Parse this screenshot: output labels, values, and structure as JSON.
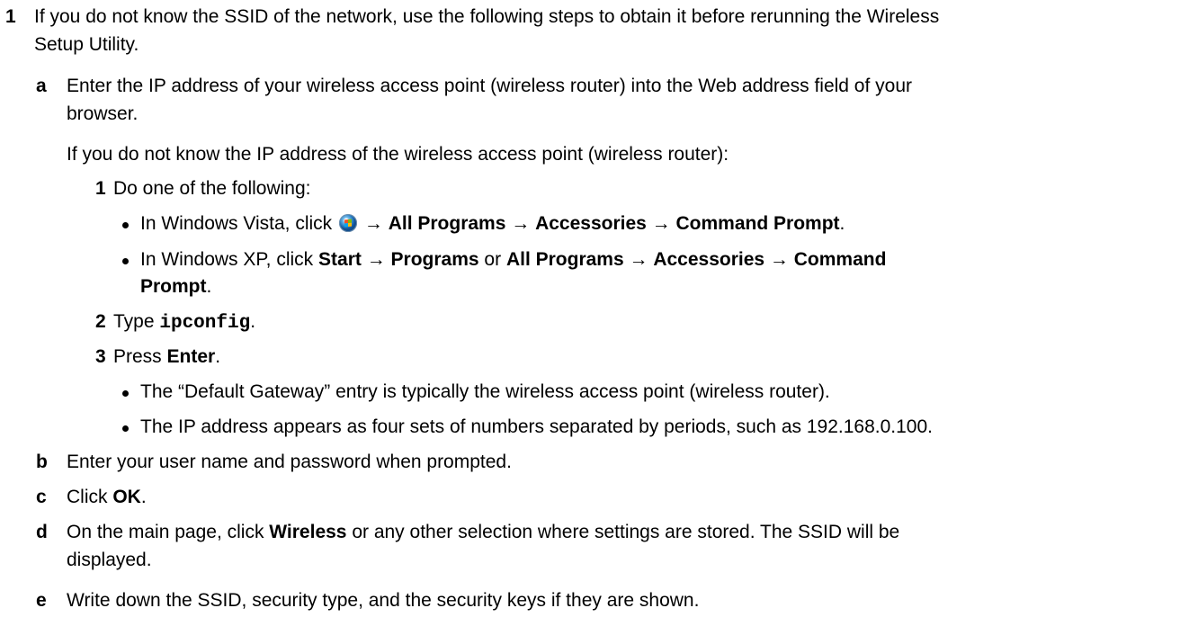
{
  "step1": {
    "num": "1",
    "text_l1": "If you do not know the SSID of the network, use the following steps to obtain it before rerunning the Wireless",
    "text_l2": "Setup Utility."
  },
  "a": {
    "letter": "a",
    "text_l1": "Enter the IP address of your wireless access point (wireless router) into the Web address field of your",
    "text_l2": "browser.",
    "intro": "If you do not know the IP address of the wireless access point (wireless router):",
    "sub1": {
      "num": "1",
      "text": "Do one of the following:",
      "vista": {
        "pre": "In Windows Vista, click ",
        "icon": "windows-start-orb-icon",
        "arrow": " → ",
        "all_programs": "All Programs",
        "accessories": "Accessories",
        "command_prompt": "Command Prompt",
        "end": "."
      },
      "xp": {
        "pre": "In Windows XP, click ",
        "start": "Start",
        "programs": "Programs",
        "or": " or ",
        "all_programs": "All Programs",
        "accessories": "Accessories",
        "command": "Command",
        "prompt": "Prompt",
        "end": "."
      }
    },
    "sub2": {
      "num": "2",
      "pre": "Type ",
      "code": "ipconfig",
      "end": "."
    },
    "sub3": {
      "num": "3",
      "pre": "Press ",
      "key": "Enter",
      "end": ".",
      "bullet1": "The “Default Gateway” entry is typically the wireless access point (wireless router).",
      "bullet2": "The IP address appears as four sets of numbers separated by periods, such as 192.168.0.100."
    }
  },
  "b": {
    "letter": "b",
    "text": "Enter your user name and password when prompted."
  },
  "c": {
    "letter": "c",
    "pre": "Click ",
    "ok": "OK",
    "end": "."
  },
  "d": {
    "letter": "d",
    "pre": "On the main page, click ",
    "wireless": "Wireless",
    "post": " or any other selection where settings are stored. The SSID will be",
    "text_l2": "displayed."
  },
  "e": {
    "letter": "e",
    "text": "Write down the SSID, security type, and the security keys if they are shown."
  }
}
